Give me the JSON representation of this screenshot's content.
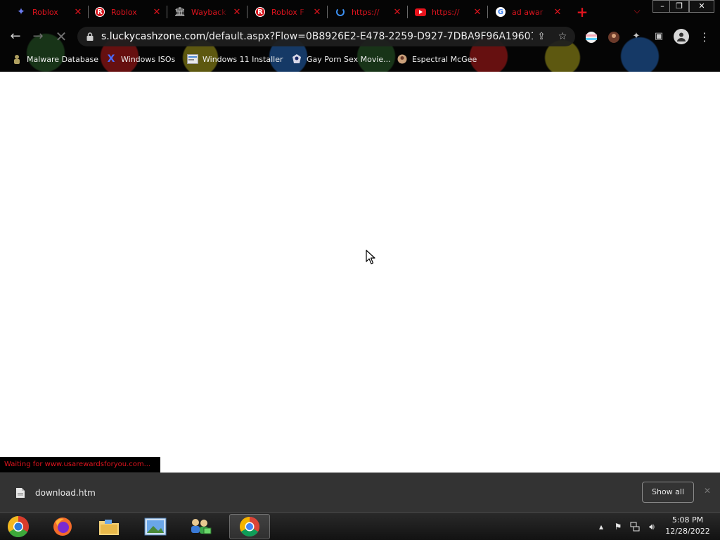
{
  "tabs": [
    {
      "title": "Roblox",
      "favicon": "discord-icon"
    },
    {
      "title": "Roblox",
      "favicon": "roblox-icon"
    },
    {
      "title": "Wayback",
      "favicon": "museum-icon"
    },
    {
      "title": "Roblox F",
      "favicon": "roblox-icon"
    },
    {
      "title": "https://",
      "favicon": "loading-spinner-icon"
    },
    {
      "title": "https://",
      "favicon": "youtube-icon"
    },
    {
      "title": "ad awar",
      "favicon": "google-icon"
    }
  ],
  "toolbar": {
    "url_host": "s.luckycashzone.com",
    "url_path": "/default.aspx?Flow=0B8926E2-E478-2259-D927-7DBA9F96A196016E..."
  },
  "bookmarks": [
    {
      "label": "Malware Database",
      "icon": "malware-icon"
    },
    {
      "label": "Windows ISOs",
      "icon": "x-icon"
    },
    {
      "label": "Windows 11 Installer",
      "icon": "installer-icon"
    },
    {
      "label": "Gay Porn Sex Movie...",
      "icon": "site-icon"
    },
    {
      "label": "Espectral McGee",
      "icon": "profile-icon"
    }
  ],
  "status": {
    "text": "Waiting for www.usarewardsforyou.com..."
  },
  "download": {
    "filename": "download.htm",
    "show_all_label": "Show all"
  },
  "clock": {
    "time": "5:08 PM",
    "date": "12/28/2022"
  },
  "colors": {
    "tab_text": "#e0141e",
    "header_bg": "#050505",
    "shelf_bg": "#333333"
  }
}
